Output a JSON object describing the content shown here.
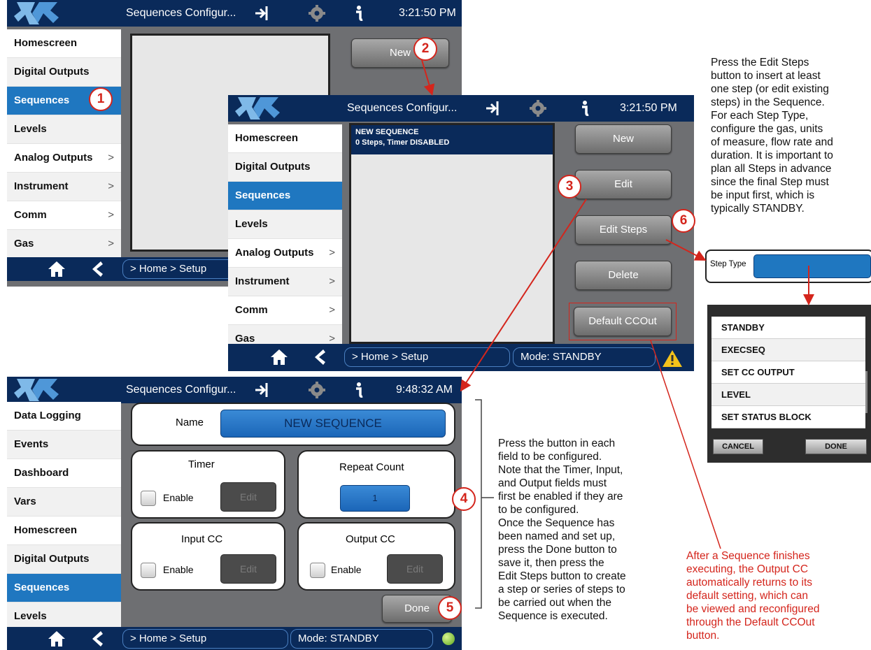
{
  "screen1": {
    "title": "Sequences Configur...",
    "time": "3:21:50 PM",
    "menu": [
      {
        "label": "Homescreen",
        "chev": ""
      },
      {
        "label": "Digital Outputs",
        "chev": ""
      },
      {
        "label": "Sequences",
        "chev": ""
      },
      {
        "label": "Levels",
        "chev": ""
      },
      {
        "label": "Analog Outputs",
        "chev": ">"
      },
      {
        "label": "Instrument",
        "chev": ">"
      },
      {
        "label": "Comm",
        "chev": ">"
      },
      {
        "label": "Gas",
        "chev": ">"
      }
    ],
    "new_label": "New",
    "breadcrumb": "> Home > Setup"
  },
  "screen2": {
    "title": "Sequences Configur...",
    "time": "3:21:50 PM",
    "menu": [
      {
        "label": "Homescreen",
        "chev": ""
      },
      {
        "label": "Digital Outputs",
        "chev": ""
      },
      {
        "label": "Sequences",
        "chev": ""
      },
      {
        "label": "Levels",
        "chev": ""
      },
      {
        "label": "Analog Outputs",
        "chev": ">"
      },
      {
        "label": "Instrument",
        "chev": ">"
      },
      {
        "label": "Comm",
        "chev": ">"
      },
      {
        "label": "Gas",
        "chev": ">"
      }
    ],
    "list_title": "NEW SEQUENCE",
    "list_sub": "0 Steps, Timer DISABLED",
    "buttons": {
      "new": "New",
      "edit": "Edit",
      "edit_steps": "Edit Steps",
      "delete": "Delete",
      "default_ccout": "Default CCOut"
    },
    "breadcrumb": "> Home > Setup",
    "mode": "Mode: STANDBY"
  },
  "screen3": {
    "title": "Sequences Configur...",
    "time": "9:48:32 AM",
    "menu": [
      {
        "label": "Data Logging"
      },
      {
        "label": "Events"
      },
      {
        "label": "Dashboard"
      },
      {
        "label": "Vars"
      },
      {
        "label": "Homescreen"
      },
      {
        "label": "Digital Outputs"
      },
      {
        "label": "Sequences"
      },
      {
        "label": "Levels"
      }
    ],
    "name_label": "Name",
    "name_value": "NEW SEQUENCE",
    "timer_label": "Timer",
    "repeat_label": "Repeat Count",
    "repeat_value": "1",
    "input_label": "Input CC",
    "output_label": "Output CC",
    "enable_label": "Enable",
    "edit_label": "Edit",
    "done_label": "Done",
    "breadcrumb": "> Home > Setup",
    "mode": "Mode: STANDBY"
  },
  "step_type": {
    "label": "Step Type",
    "options": [
      "STANDBY",
      "EXECSEQ",
      "SET CC OUTPUT",
      "LEVEL",
      "SET STATUS BLOCK"
    ],
    "cancel": "CANCEL",
    "done": "DONE"
  },
  "callouts": [
    "1",
    "2",
    "3",
    "4",
    "5",
    "6"
  ],
  "notes": {
    "top_right": [
      "Press the Edit Steps",
      "button to insert at least",
      "one step (or edit existing",
      "steps) in the Sequence.",
      "For each Step Type,",
      "configure the gas, units",
      "of measure, flow rate and",
      "duration. It is important to",
      "plan all Steps in advance",
      "since the final Step must",
      "be input first, which is",
      "typically STANDBY."
    ],
    "middle": [
      "Press the button in each",
      "field to be configured.",
      "Note that the Timer, Input,",
      "and Output fields must",
      "first be enabled if they are",
      "to be configured.",
      "Once the Sequence has",
      "been named and set up,",
      "press the Done button to",
      "save it, then press the",
      "Edit Steps button to create",
      "a step or series of steps to",
      "be carried out when the",
      "Sequence is executed."
    ],
    "bottom_right": [
      "After a Sequence finishes",
      "executing, the Output CC",
      "automatically returns to its",
      "default setting, which can",
      "be viewed and reconfigured",
      "through the Default CCOut",
      "button."
    ]
  },
  "colors": {
    "accent_blue": "#1f77c0",
    "navy": "#0a2a5a",
    "callout_red": "#d4251c",
    "panel_grey": "#6e6f72"
  },
  "icons": [
    "logo-icon",
    "login-arrow-icon",
    "gear-icon",
    "info-icon",
    "home-icon",
    "back-chevron-icon",
    "warning-icon",
    "status-led-icon"
  ]
}
